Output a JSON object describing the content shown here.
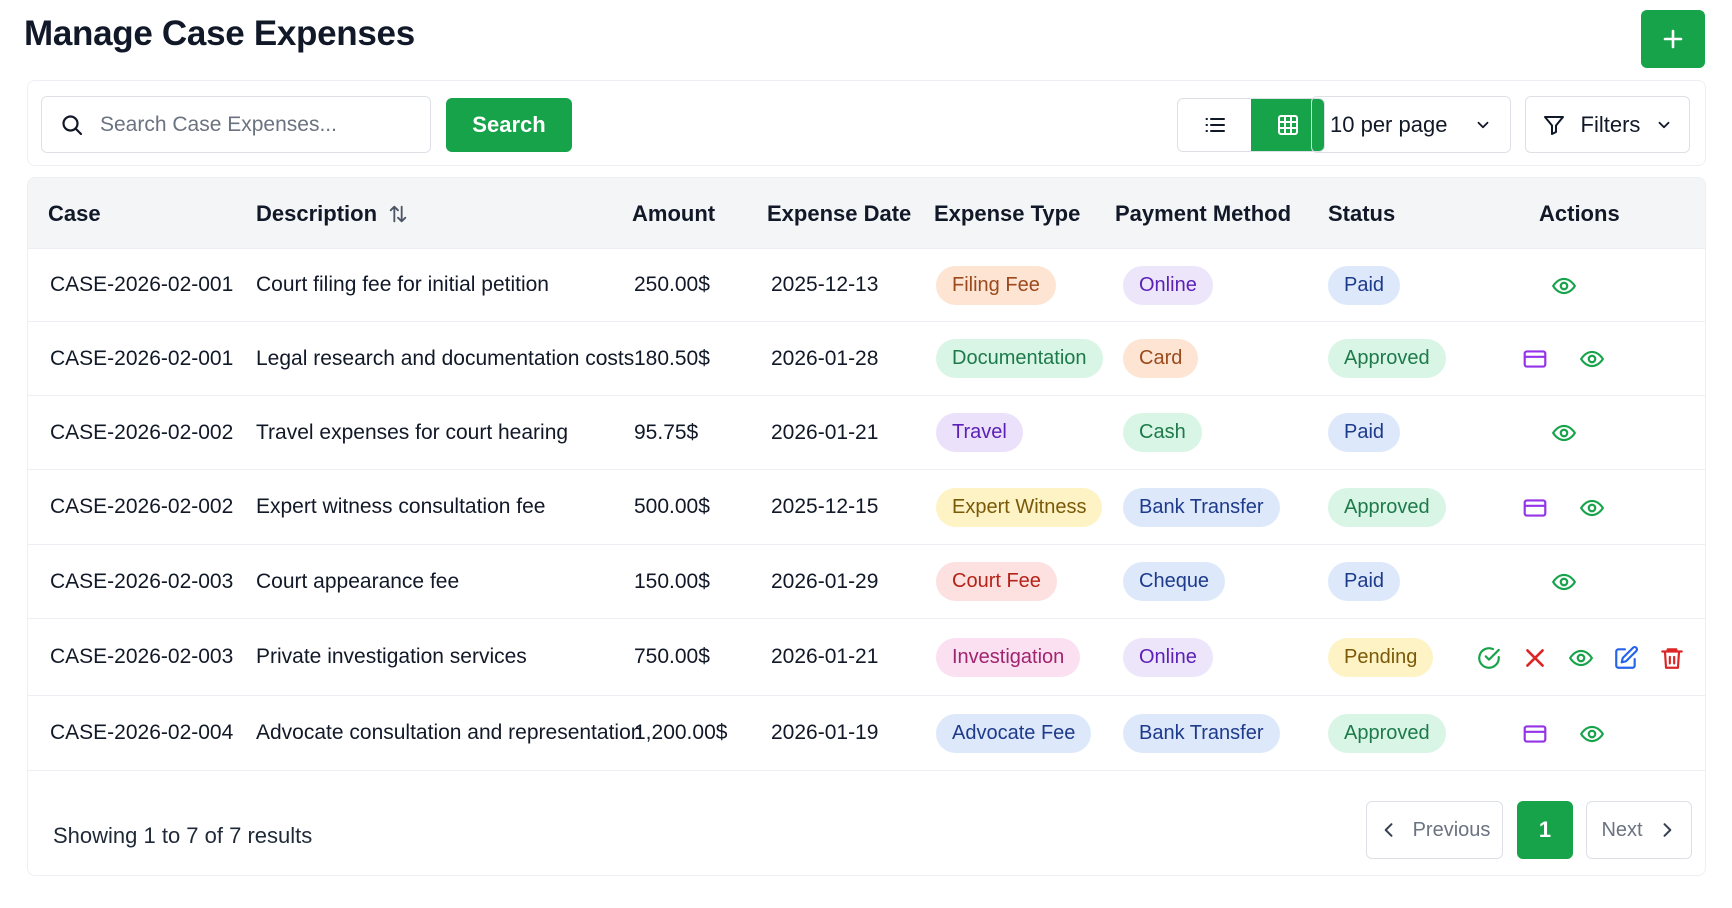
{
  "page": {
    "title": "Manage Case Expenses",
    "add_icon": "plus-icon"
  },
  "toolbar": {
    "search_placeholder": "Search Case Expenses...",
    "search_label": "Search",
    "per_page": "10 per page",
    "filters_label": "Filters"
  },
  "table": {
    "headers": {
      "case": "Case",
      "description": "Description",
      "amount": "Amount",
      "expense_date": "Expense Date",
      "expense_type": "Expense Type",
      "payment_method": "Payment Method",
      "status": "Status",
      "actions": "Actions"
    },
    "rows": [
      {
        "case": "CASE-2026-02-001",
        "description": "Court filing fee for initial petition",
        "amount": "250.00$",
        "date": "2025-12-13",
        "type": "Filing Fee",
        "method": "Online",
        "status": "Paid",
        "actions": [
          "view"
        ]
      },
      {
        "case": "CASE-2026-02-001",
        "description": "Legal research and documentation costs",
        "amount": "180.50$",
        "date": "2026-01-28",
        "type": "Documentation",
        "method": "Card",
        "status": "Approved",
        "actions": [
          "pay",
          "view"
        ]
      },
      {
        "case": "CASE-2026-02-002",
        "description": "Travel expenses for court hearing",
        "amount": "95.75$",
        "date": "2026-01-21",
        "type": "Travel",
        "method": "Cash",
        "status": "Paid",
        "actions": [
          "view"
        ]
      },
      {
        "case": "CASE-2026-02-002",
        "description": "Expert witness consultation fee",
        "amount": "500.00$",
        "date": "2025-12-15",
        "type": "Expert Witness",
        "method": "Bank Transfer",
        "status": "Approved",
        "actions": [
          "pay",
          "view"
        ]
      },
      {
        "case": "CASE-2026-02-003",
        "description": "Court appearance fee",
        "amount": "150.00$",
        "date": "2026-01-29",
        "type": "Court Fee",
        "method": "Cheque",
        "status": "Paid",
        "actions": [
          "view"
        ]
      },
      {
        "case": "CASE-2026-02-003",
        "description": "Private investigation services",
        "amount": "750.00$",
        "date": "2026-01-21",
        "type": "Investigation",
        "method": "Online",
        "status": "Pending",
        "actions": [
          "approve",
          "reject",
          "view",
          "edit",
          "delete"
        ]
      },
      {
        "case": "CASE-2026-02-004",
        "description": "Advocate consultation and representation",
        "amount": "1,200.00$",
        "date": "2026-01-19",
        "type": "Advocate Fee",
        "method": "Bank Transfer",
        "status": "Approved",
        "actions": [
          "pay",
          "view"
        ]
      }
    ]
  },
  "colors": {
    "accent": "#16a34a",
    "type": {
      "Filing Fee": {
        "bg": "#fde4d3",
        "fg": "#9a4a1c"
      },
      "Documentation": {
        "bg": "#d9f5e6",
        "fg": "#1d7a4a"
      },
      "Travel": {
        "bg": "#ece1fb",
        "fg": "#5b21b6"
      },
      "Expert Witness": {
        "bg": "#fdf3c4",
        "fg": "#7a5a08"
      },
      "Court Fee": {
        "bg": "#fde0e0",
        "fg": "#b42318"
      },
      "Investigation": {
        "bg": "#fbe0f1",
        "fg": "#a0246e"
      },
      "Advocate Fee": {
        "bg": "#dde9fb",
        "fg": "#1e3a8a"
      }
    },
    "method": {
      "Online": {
        "bg": "#ede6fb",
        "fg": "#5b21b6"
      },
      "Card": {
        "bg": "#fde4d3",
        "fg": "#9a4a1c"
      },
      "Cash": {
        "bg": "#d9f5e6",
        "fg": "#1d7a4a"
      },
      "Bank Transfer": {
        "bg": "#dde9fb",
        "fg": "#1e3a8a"
      },
      "Cheque": {
        "bg": "#dde9fb",
        "fg": "#1e3a8a"
      }
    },
    "status": {
      "Paid": {
        "bg": "#dde9fb",
        "fg": "#1e3a8a"
      },
      "Approved": {
        "bg": "#d9f5e6",
        "fg": "#1d7a4a"
      },
      "Pending": {
        "bg": "#fdf3c4",
        "fg": "#7a5a08"
      }
    }
  },
  "footer": {
    "summary": "Showing 1 to 7 of 7 results",
    "previous_label": "Previous",
    "current_page": "1",
    "next_label": "Next"
  }
}
